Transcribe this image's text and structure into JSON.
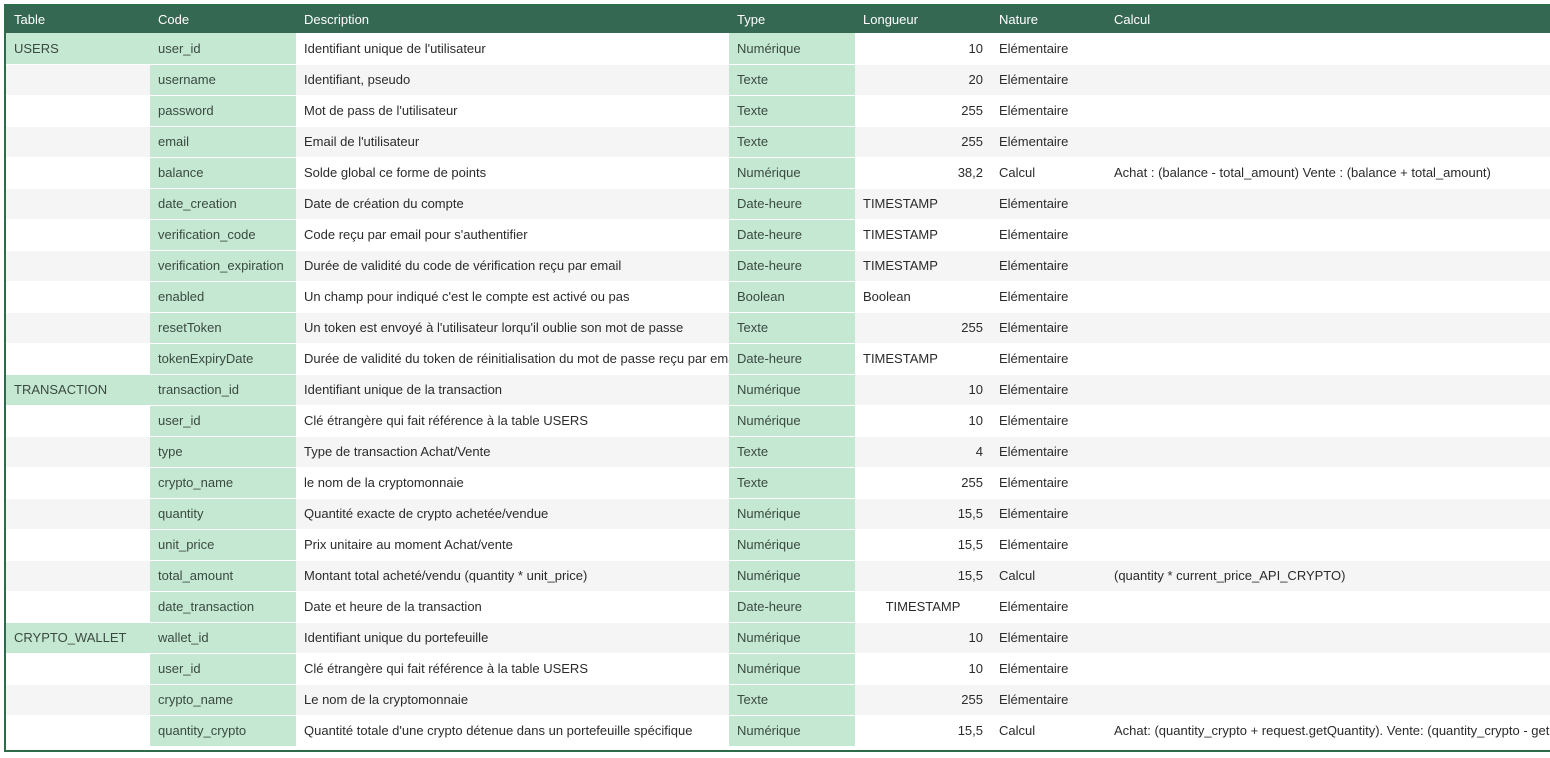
{
  "columns": {
    "table": "Table",
    "code": "Code",
    "description": "Description",
    "type": "Type",
    "length": "Longueur",
    "nature": "Nature",
    "calc": "Calcul"
  },
  "rows": [
    {
      "table": "USERS",
      "code": "user_id",
      "description": "Identifiant unique de l'utilisateur",
      "type": "Numérique",
      "length": "10",
      "nature": "Elémentaire",
      "calc": ""
    },
    {
      "table": "",
      "code": "username",
      "description": "Identifiant, pseudo",
      "type": "Texte",
      "length": "20",
      "nature": "Elémentaire",
      "calc": ""
    },
    {
      "table": "",
      "code": "password",
      "description": "Mot de pass de l'utilisateur",
      "type": "Texte",
      "length": "255",
      "nature": "Elémentaire",
      "calc": ""
    },
    {
      "table": "",
      "code": "email",
      "description": "Email de l'utilisateur",
      "type": "Texte",
      "length": "255",
      "nature": "Elémentaire",
      "calc": ""
    },
    {
      "table": "",
      "code": "balance",
      "description": "Solde global ce forme de points",
      "type": "Numérique",
      "length": "38,2",
      "nature": "Calcul",
      "calc": "Achat : (balance - total_amount) Vente : (balance + total_amount)"
    },
    {
      "table": "",
      "code": "date_creation",
      "description": "Date de création du compte",
      "type": "Date-heure",
      "length": "TIMESTAMP",
      "nature": "Elémentaire",
      "calc": ""
    },
    {
      "table": "",
      "code": "verification_code",
      "description": "Code reçu par email pour s'authentifier",
      "type": "Date-heure",
      "length": "TIMESTAMP",
      "nature": "Elémentaire",
      "calc": ""
    },
    {
      "table": "",
      "code": "verification_expiration",
      "description": "Durée de validité du code de vérification reçu par email",
      "type": "Date-heure",
      "length": "TIMESTAMP",
      "nature": "Elémentaire",
      "calc": ""
    },
    {
      "table": "",
      "code": "enabled",
      "description": "Un champ pour indiqué c'est le compte est activé ou pas",
      "type": "Boolean",
      "length": "Boolean",
      "nature": "Elémentaire",
      "calc": ""
    },
    {
      "table": "",
      "code": "resetToken",
      "description": "Un token est envoyé à l'utilisateur lorqu'il oublie son mot de passe",
      "type": "Texte",
      "length": "255",
      "nature": "Elémentaire",
      "calc": ""
    },
    {
      "table": "",
      "code": "tokenExpiryDate",
      "description": "Durée de validité du token de réinitialisation du mot de passe reçu par email",
      "type": "Date-heure",
      "length": "TIMESTAMP",
      "nature": "Elémentaire",
      "calc": ""
    },
    {
      "table": "TRANSACTION",
      "code": "transaction_id",
      "description": "Identifiant unique de la transaction",
      "type": "Numérique",
      "length": "10",
      "nature": "Elémentaire",
      "calc": ""
    },
    {
      "table": "",
      "code": "user_id",
      "description": "Clé étrangère qui fait référence à la table USERS",
      "type": "Numérique",
      "length": "10",
      "nature": "Elémentaire",
      "calc": ""
    },
    {
      "table": "",
      "code": "type",
      "description": "Type de transaction Achat/Vente",
      "type": "Texte",
      "length": "4",
      "nature": "Elémentaire",
      "calc": ""
    },
    {
      "table": "",
      "code": "crypto_name",
      "description": "le nom de la cryptomonnaie",
      "type": "Texte",
      "length": "255",
      "nature": "Elémentaire",
      "calc": ""
    },
    {
      "table": "",
      "code": "quantity",
      "description": "Quantité exacte de crypto achetée/vendue",
      "type": "Numérique",
      "length": "15,5",
      "nature": "Elémentaire",
      "calc": ""
    },
    {
      "table": "",
      "code": "unit_price",
      "description": "Prix unitaire au moment Achat/vente",
      "type": "Numérique",
      "length": "15,5",
      "nature": "Elémentaire",
      "calc": ""
    },
    {
      "table": "",
      "code": "total_amount",
      "description": "Montant total acheté/vendu (quantity * unit_price)",
      "type": "Numérique",
      "length": "15,5",
      "nature": "Calcul",
      "calc": "(quantity * current_price_API_CRYPTO)"
    },
    {
      "table": "",
      "code": "date_transaction",
      "description": "Date et heure de la transaction",
      "type": "Date-heure",
      "length": "TIMESTAMP",
      "nature": "Elémentaire",
      "calc": ""
    },
    {
      "table": "CRYPTO_WALLET",
      "code": "wallet_id",
      "description": "Identifiant unique du portefeuille",
      "type": "Numérique",
      "length": "10",
      "nature": "Elémentaire",
      "calc": ""
    },
    {
      "table": "",
      "code": "user_id",
      "description": "Clé étrangère qui fait référence à la table USERS",
      "type": "Numérique",
      "length": "10",
      "nature": "Elémentaire",
      "calc": ""
    },
    {
      "table": "",
      "code": "crypto_name",
      "description": "Le nom de la cryptomonnaie",
      "type": "Texte",
      "length": "255",
      "nature": "Elémentaire",
      "calc": ""
    },
    {
      "table": "",
      "code": "quantity_crypto",
      "description": "Quantité totale d'une crypto détenue dans un portefeuille spécifique",
      "type": "Numérique",
      "length": "15,5",
      "nature": "Calcul",
      "calc": "Achat: (quantity_crypto + request.getQuantity). Vente: (quantity_crypto - getQuantity)"
    }
  ]
}
